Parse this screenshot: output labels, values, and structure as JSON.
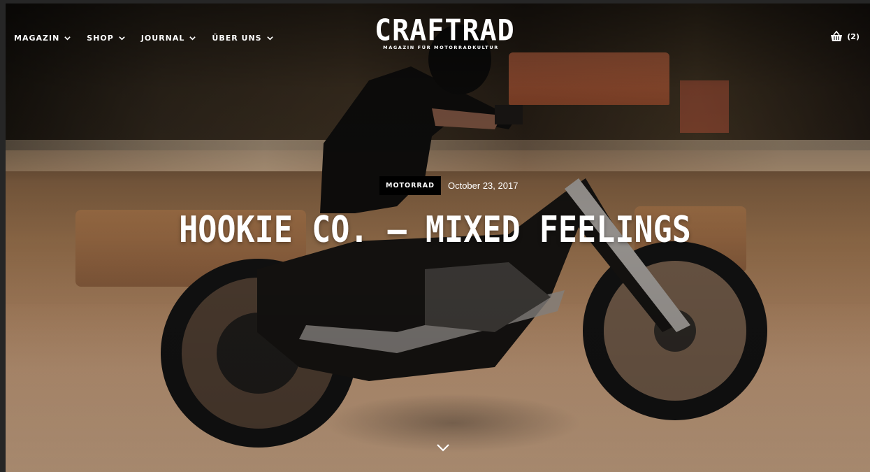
{
  "site": {
    "logo_title": "CRAFTRAD",
    "logo_subtitle": "MAGAZIN FÜR MOTORRADKULTUR"
  },
  "nav": {
    "items": [
      {
        "label": "MAGAZIN"
      },
      {
        "label": "SHOP"
      },
      {
        "label": "JOURNAL"
      },
      {
        "label": "ÜBER UNS"
      }
    ]
  },
  "cart": {
    "count_label": "(2)",
    "icon": "basket-icon"
  },
  "article": {
    "category": "MOTORRAD",
    "date": "October 23, 2017",
    "title": "HOOKIE CO. – MIXED FEELINGS"
  },
  "icons": {
    "nav_dropdown": "chevron-down-icon",
    "scroll": "chevron-down-icon"
  },
  "colors": {
    "text": "#ffffff",
    "badge_bg": "#000000"
  }
}
